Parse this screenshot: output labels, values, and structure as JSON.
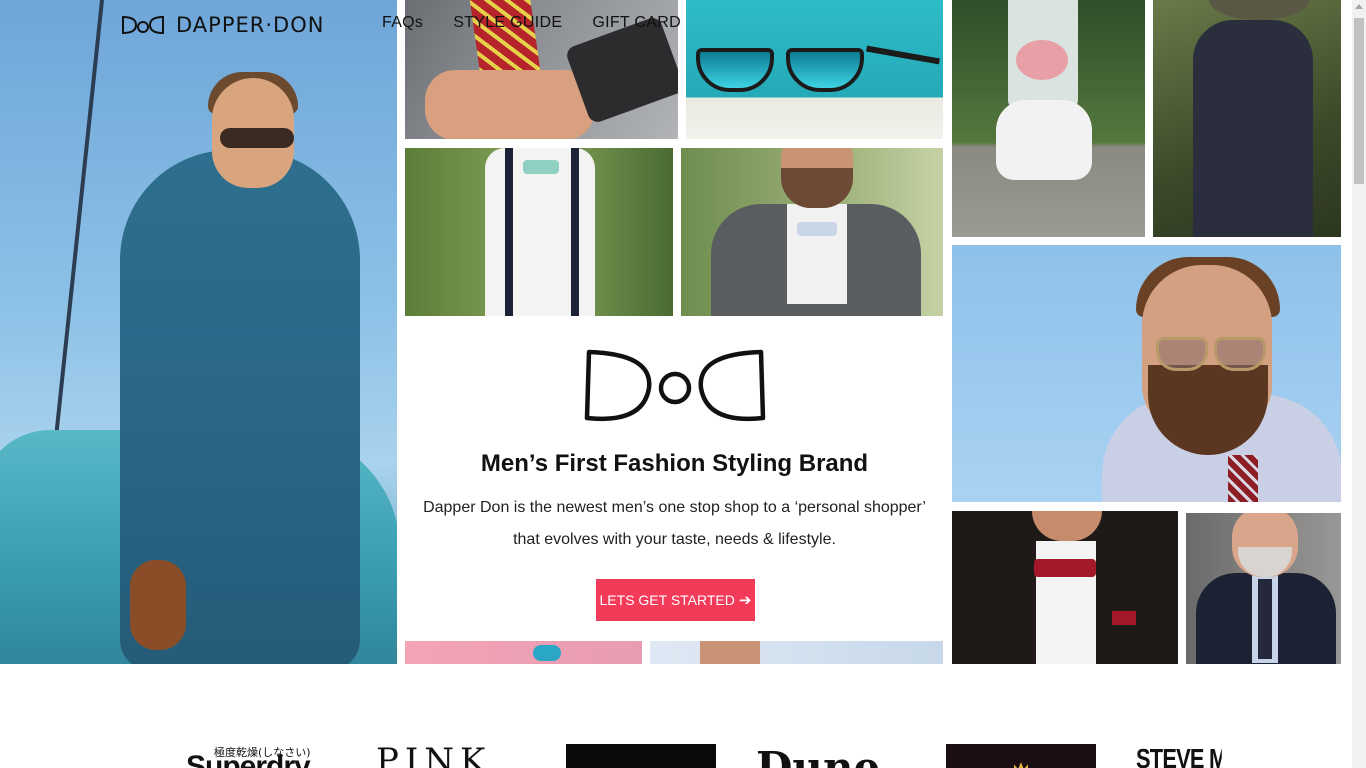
{
  "header": {
    "logo_mark": "DoD",
    "logo_text": "DAPPER·DON",
    "nav": [
      "FAQs",
      "STYLE GUIDE",
      "GIFT CARD"
    ]
  },
  "hero": {
    "title": "Men’s First Fashion Styling Brand",
    "description_line1": "Dapper Don is the newest men’s one stop shop to a ‘personal shopper’",
    "description_line2": "that evolves with your taste, needs & lifestyle.",
    "cta_label": "LETS GET STARTED",
    "cta_icon": "arrow-right-icon"
  },
  "brands": {
    "superdry_jp": "極度乾燥(しなさい)",
    "superdry": "Superdry",
    "pink": "PINK",
    "dune": "Dune",
    "steve": "STEVE MAD"
  },
  "colors": {
    "accent": "#f33a59",
    "text": "#111111"
  }
}
